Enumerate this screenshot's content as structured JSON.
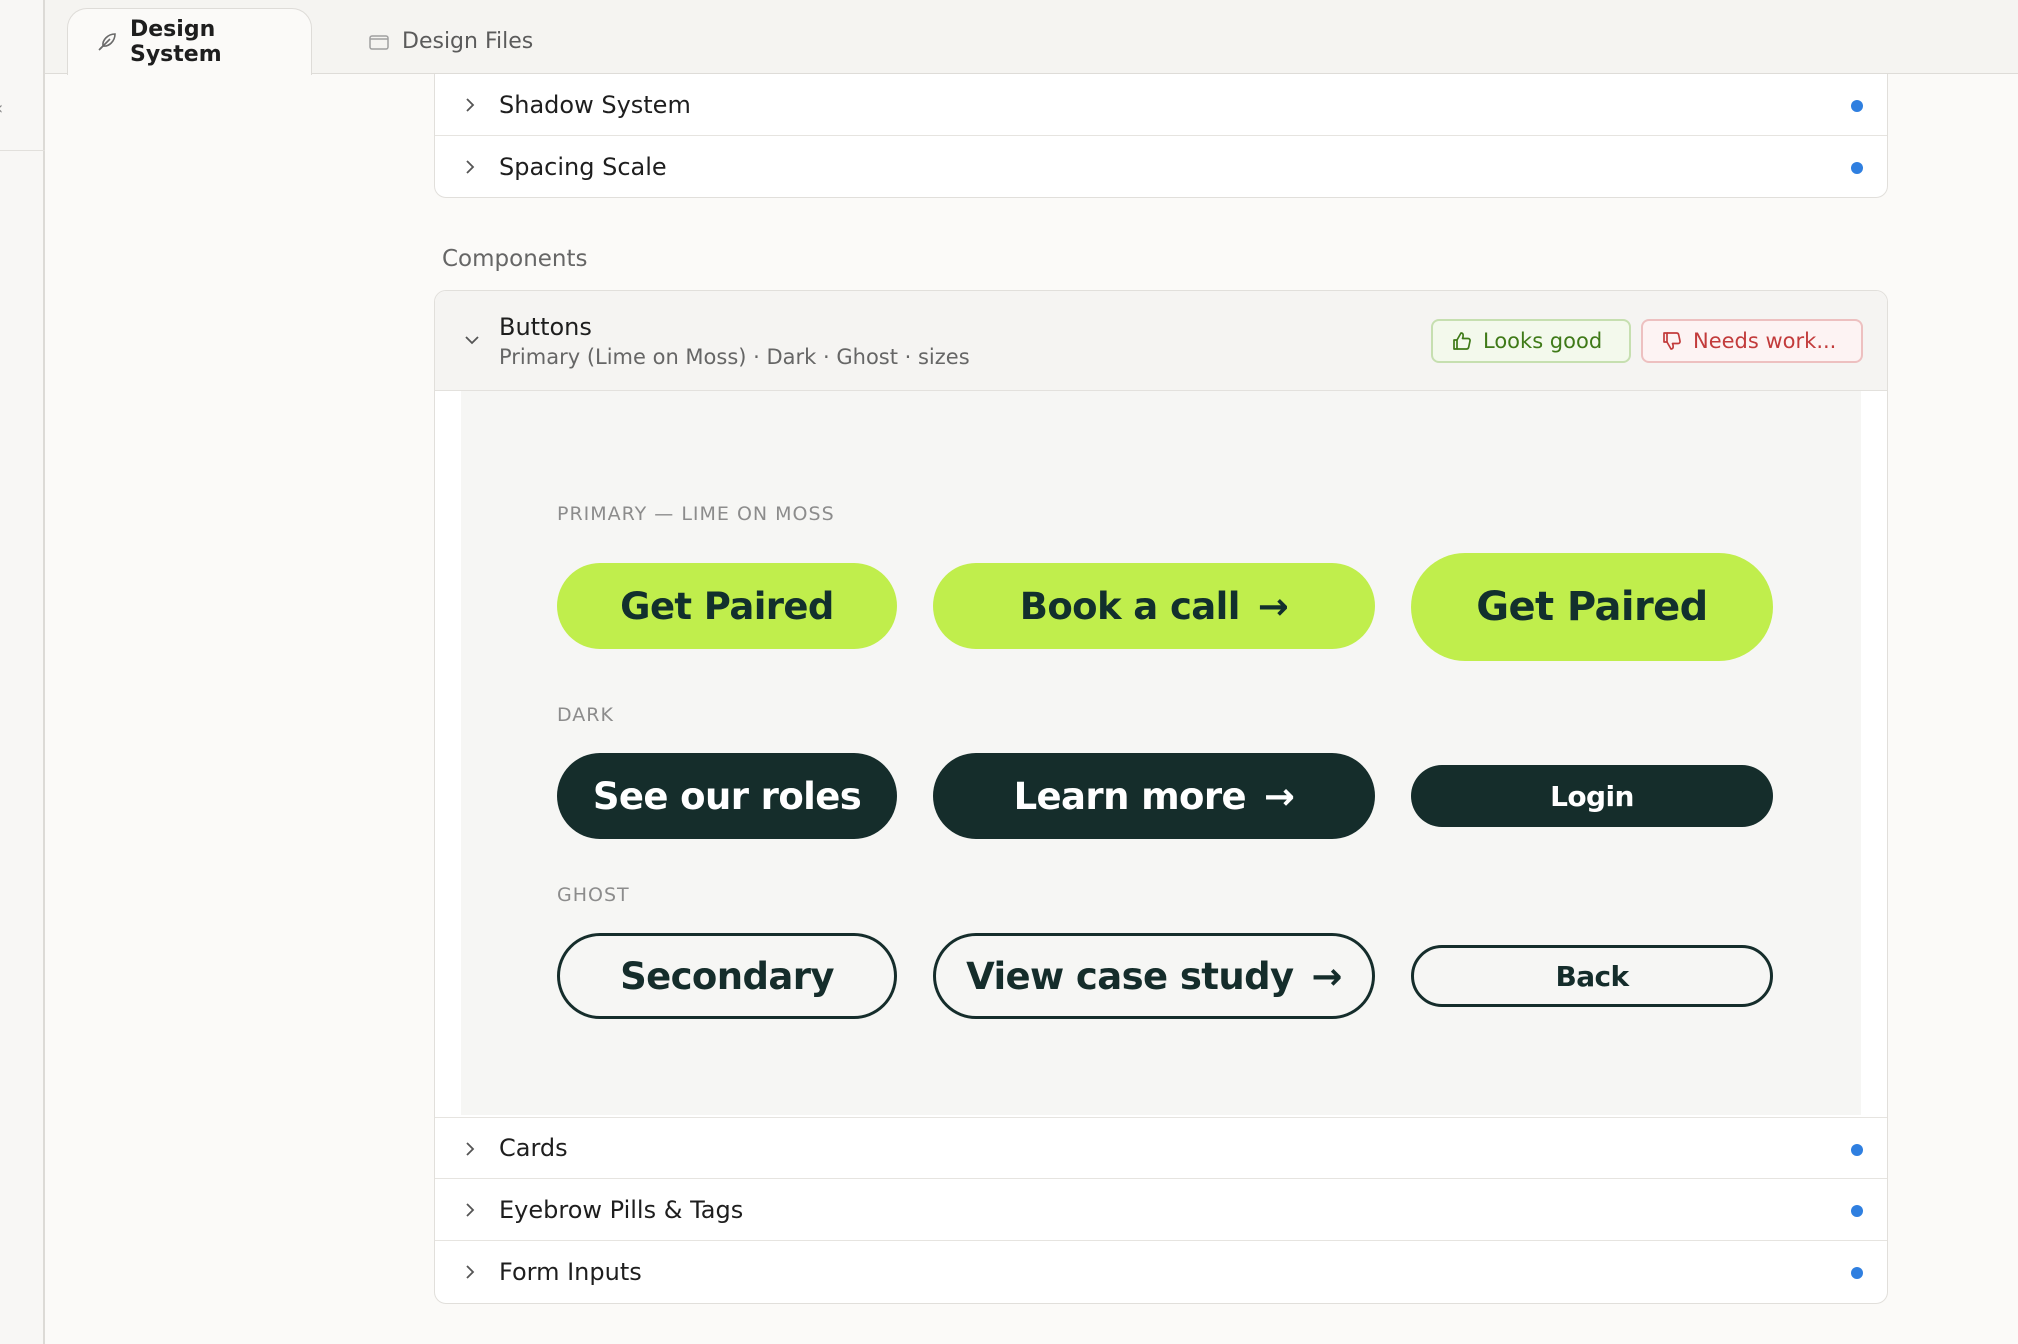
{
  "tabs": [
    {
      "label": "Design System",
      "icon": "feather-icon",
      "active": true
    },
    {
      "label": "Design Files",
      "icon": "folder-icon",
      "active": false
    }
  ],
  "top_rows": [
    {
      "label": "Shadow System",
      "status_color": "#2f7fe0"
    },
    {
      "label": "Spacing Scale",
      "status_color": "#2f7fe0"
    }
  ],
  "section_label": "Components",
  "expanded": {
    "title": "Buttons",
    "subtitle": "Primary (Lime on Moss) · Dark · Ghost · sizes",
    "feedback_good": "Looks good",
    "feedback_bad": "Needs work..."
  },
  "preview": {
    "primary_label": "PRIMARY — LIME ON MOSS",
    "primary_buttons": [
      "Get Paired",
      "Book a call",
      "Get Paired"
    ],
    "dark_label": "DARK",
    "dark_buttons": [
      "See our roles",
      "Learn more",
      "Login"
    ],
    "ghost_label": "GHOST",
    "ghost_buttons": [
      "Secondary",
      "View case study",
      "Back"
    ],
    "arrow": "→"
  },
  "bottom_rows": [
    {
      "label": "Cards"
    },
    {
      "label": "Eyebrow Pills & Tags"
    },
    {
      "label": "Form Inputs"
    }
  ],
  "colors": {
    "lime": "#c0ee4c",
    "moss": "#152d2b",
    "status_dot": "#2f7fe0",
    "good": "#3f7a18",
    "bad": "#c23b3b"
  }
}
